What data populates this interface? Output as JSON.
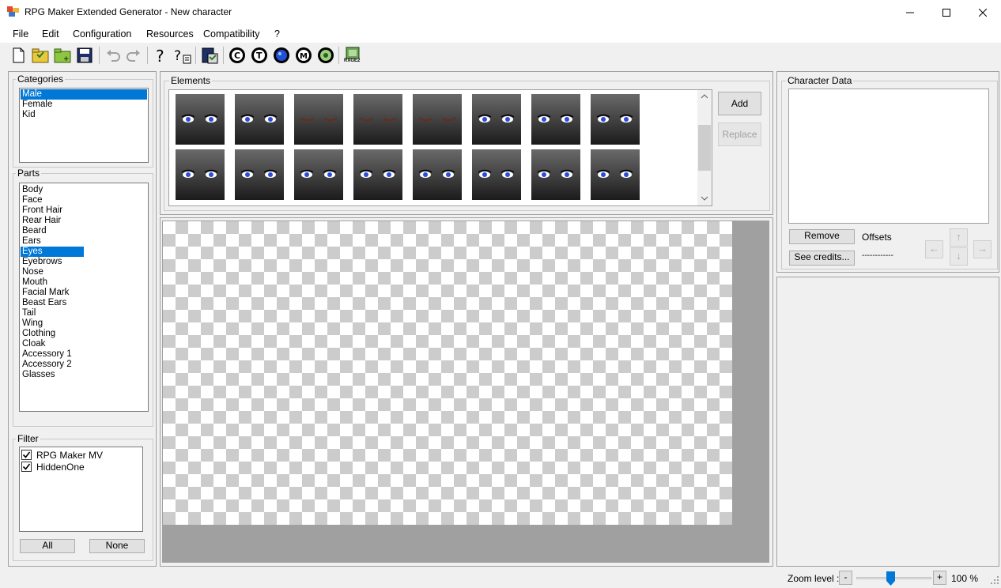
{
  "window": {
    "title": "RPG Maker Extended Generator - New character"
  },
  "menu": {
    "items": [
      "File",
      "Edit",
      "Configuration",
      "Resources",
      "Compatibility",
      "?"
    ]
  },
  "toolbar": {
    "icons": [
      "new-file-icon",
      "open-folder-icon",
      "new-folder-icon",
      "save-icon",
      "undo-icon",
      "redo-icon",
      "help-icon",
      "help-document-icon",
      "export-icon",
      "c-circle-icon",
      "t-circle-icon",
      "blue-orb-icon",
      "m-circle-icon",
      "settings-circle-icon",
      "rxge2-icon"
    ],
    "rxge2_label": "RXGE2"
  },
  "categories": {
    "title": "Categories",
    "items": [
      "Male",
      "Female",
      "Kid"
    ],
    "selected": "Male"
  },
  "parts": {
    "title": "Parts",
    "items": [
      "Body",
      "Face",
      "Front Hair",
      "Rear Hair",
      "Beard",
      "Ears",
      "Eyes",
      "Eyebrows",
      "Nose",
      "Mouth",
      "Facial Mark",
      "Beast Ears",
      "Tail",
      "Wing",
      "Clothing",
      "Cloak",
      "Accessory 1",
      "Accessory 2",
      "Glasses"
    ],
    "selected": "Eyes"
  },
  "filter": {
    "title": "Filter",
    "items": [
      {
        "label": "RPG Maker MV",
        "checked": true
      },
      {
        "label": "HiddenOne",
        "checked": true
      }
    ],
    "all_label": "All",
    "none_label": "None"
  },
  "elements": {
    "title": "Elements",
    "add_label": "Add",
    "replace_label": "Replace",
    "thumbnail_count": 16
  },
  "character_data": {
    "title": "Character Data",
    "remove_label": "Remove",
    "credits_label": "See credits...",
    "offsets_label": "Offsets",
    "offsets_value": "------------",
    "arrows": {
      "up": "↑",
      "down": "↓",
      "left": "←",
      "right": "→"
    }
  },
  "status": {
    "zoom_label": "Zoom level :",
    "zoom_minus": "-",
    "zoom_plus": "+",
    "zoom_value": "100 %",
    "zoom_percent": 100
  },
  "colors": {
    "selection": "#0078d7",
    "eye_blue": "#2c4bd8"
  }
}
